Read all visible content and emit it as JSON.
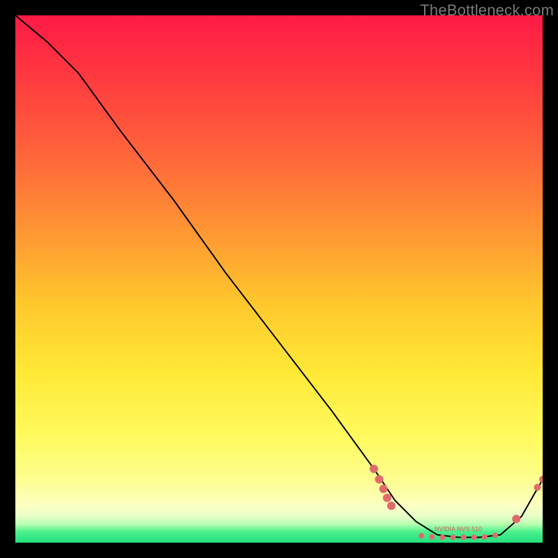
{
  "watermark": "TheBottleneck.com",
  "chart_data": {
    "type": "line",
    "title": "",
    "xlabel": "",
    "ylabel": "",
    "xlim": [
      0,
      100
    ],
    "ylim": [
      0,
      100
    ],
    "grid": false,
    "legend": false,
    "series": [
      {
        "name": "bottleneck-curve",
        "x": [
          0,
          6,
          12,
          20,
          30,
          40,
          50,
          60,
          68,
          72,
          76,
          80,
          84,
          88,
          92,
          96,
          100
        ],
        "y": [
          100,
          95,
          89,
          78,
          65,
          51,
          38,
          25,
          14,
          8,
          4,
          1.5,
          1,
          1,
          1.5,
          5,
          12
        ],
        "stroke": "#000000",
        "stroke_width": 2
      }
    ],
    "markers": [
      {
        "name": "cluster-left-1",
        "x": 68.0,
        "y": 14.0,
        "r": 6,
        "fill": "#e06b6b"
      },
      {
        "name": "cluster-left-2",
        "x": 69.0,
        "y": 12.0,
        "r": 6,
        "fill": "#e06b6b"
      },
      {
        "name": "cluster-left-3",
        "x": 69.8,
        "y": 10.2,
        "r": 6,
        "fill": "#e06b6b"
      },
      {
        "name": "cluster-left-4",
        "x": 70.5,
        "y": 8.5,
        "r": 6,
        "fill": "#e06b6b"
      },
      {
        "name": "cluster-left-5",
        "x": 71.3,
        "y": 7.0,
        "r": 6,
        "fill": "#e06b6b"
      },
      {
        "name": "trough-1",
        "x": 77.0,
        "y": 1.3,
        "r": 4,
        "fill": "#e06b6b"
      },
      {
        "name": "trough-2",
        "x": 79.0,
        "y": 1.1,
        "r": 4,
        "fill": "#e06b6b"
      },
      {
        "name": "trough-3",
        "x": 81.0,
        "y": 1.0,
        "r": 4,
        "fill": "#e06b6b"
      },
      {
        "name": "trough-4",
        "x": 83.0,
        "y": 1.0,
        "r": 4,
        "fill": "#e06b6b"
      },
      {
        "name": "trough-5",
        "x": 85.0,
        "y": 1.0,
        "r": 4,
        "fill": "#e06b6b"
      },
      {
        "name": "trough-6",
        "x": 87.0,
        "y": 1.0,
        "r": 4,
        "fill": "#e06b6b"
      },
      {
        "name": "trough-7",
        "x": 89.0,
        "y": 1.1,
        "r": 4,
        "fill": "#e06b6b"
      },
      {
        "name": "trough-8",
        "x": 91.0,
        "y": 1.4,
        "r": 4,
        "fill": "#e06b6b"
      },
      {
        "name": "rise-1",
        "x": 95.0,
        "y": 4.5,
        "r": 6,
        "fill": "#e06b6b"
      },
      {
        "name": "rise-2",
        "x": 99.0,
        "y": 10.5,
        "r": 5,
        "fill": "#e06b6b"
      },
      {
        "name": "rise-3",
        "x": 100.0,
        "y": 12.0,
        "r": 5,
        "fill": "#e06b6b"
      }
    ],
    "annotation": {
      "text": "NVIDIA NVS 510",
      "x": 84,
      "y": 2.2,
      "color": "#d85a5a",
      "size": 9
    }
  }
}
